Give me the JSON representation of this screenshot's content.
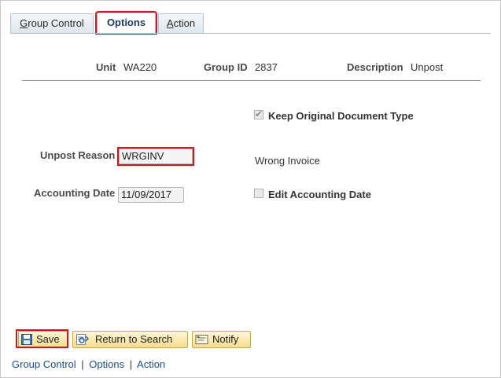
{
  "tabs": [
    {
      "label": "Group Control",
      "underline": "G"
    },
    {
      "label": "Options"
    },
    {
      "label": "Action",
      "underline": "A"
    }
  ],
  "header": {
    "unit_label": "Unit",
    "unit_value": "WA220",
    "group_label": "Group ID",
    "group_value": "2837",
    "desc_label": "Description",
    "desc_value": "Unpost"
  },
  "form": {
    "keep_original_label": "Keep Original Document Type",
    "keep_original_checked": true,
    "unpost_reason_label": "Unpost Reason",
    "unpost_reason_value": "WRGINV",
    "unpost_reason_desc": "Wrong Invoice",
    "accounting_date_label": "Accounting Date",
    "accounting_date_value": "11/09/2017",
    "edit_accounting_label": "Edit Accounting Date",
    "edit_accounting_checked": false
  },
  "toolbar": {
    "save_label": "Save",
    "return_label": "Return to Search",
    "notify_label": "Notify"
  },
  "footer_links": {
    "group_control": "Group Control",
    "sep": "|",
    "options": "Options",
    "action": "Action"
  }
}
